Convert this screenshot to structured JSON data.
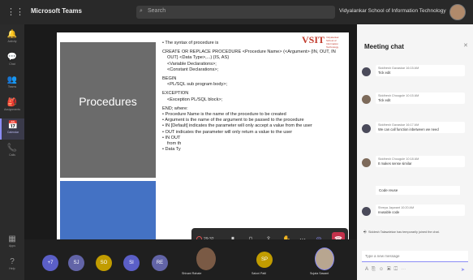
{
  "app": {
    "title": "Microsoft Teams",
    "search_placeholder": "Search",
    "org_name": "Vidyalankar School of Information Technology"
  },
  "rail": [
    {
      "icon": "bell-icon",
      "glyph": "🔔",
      "label": "Activity"
    },
    {
      "icon": "chat-icon",
      "glyph": "💬",
      "label": "Chat"
    },
    {
      "icon": "teams-icon",
      "glyph": "👥",
      "label": "Teams"
    },
    {
      "icon": "assignments-icon",
      "glyph": "🎒",
      "label": "Assignments"
    },
    {
      "icon": "calendar-icon",
      "glyph": "📅",
      "label": "Calendar"
    },
    {
      "icon": "calls-icon",
      "glyph": "📞",
      "label": "Calls"
    },
    {
      "icon": "apps-icon",
      "glyph": "▦",
      "label": "Apps"
    },
    {
      "icon": "help-icon",
      "glyph": "?",
      "label": "Help"
    }
  ],
  "slide": {
    "title": "Procedures",
    "logo": "VSIT",
    "logo_sub": "Vidyalankar School of Information Technology",
    "lines": [
      {
        "text": "The syntax of procedure is",
        "style": "bullet"
      },
      {
        "text": "CREATE OR REPLACE PROCEDURE <Procedure Name> (<Argument> {IN, OUT, IN",
        "style": "gap"
      },
      {
        "text": "OUT} <Data Type>,...) {IS, AS}",
        "style": "indent"
      },
      {
        "text": "<Variable Declarations>;",
        "style": "indent"
      },
      {
        "text": "<Constant Declarations>;",
        "style": "indent"
      },
      {
        "text": "BEGIN",
        "style": "gap"
      },
      {
        "text": "<PL/SQL sub program body>;",
        "style": "indent"
      },
      {
        "text": "EXCEPTION",
        "style": "gap"
      },
      {
        "text": "<Exception PL/SQL block>;",
        "style": "indent"
      },
      {
        "text": "END; where:",
        "style": "gap"
      },
      {
        "text": "Procedure Name is the name of the procedure to be created",
        "style": "bullet"
      },
      {
        "text": "Argument is the name of the argument to be passed to the procedure",
        "style": "bullet"
      },
      {
        "text": "IN [Default] indicates the parameter will only accept a value from the user",
        "style": "bullet"
      },
      {
        "text": "OUT indicates the parameter will only return a value to the user",
        "style": "bullet"
      },
      {
        "text": "IN OUT",
        "style": "bullet"
      },
      {
        "text": "from th",
        "style": "indent"
      },
      {
        "text": "Data Ty",
        "style": "bullet"
      }
    ]
  },
  "presenter_caption": "Sujata Sawant",
  "controls": {
    "timer": "29:32",
    "items": [
      "camera-icon",
      "mic-icon",
      "share-icon",
      "raise-hand-icon",
      "more-icon",
      "chat-toggle-icon",
      "participants-icon",
      "hangup-icon"
    ]
  },
  "participants": [
    {
      "initials": "+7",
      "color": "#5b5fc7"
    },
    {
      "initials": "SJ",
      "color": "#6264a7"
    },
    {
      "initials": "SO",
      "color": "#c19c00"
    },
    {
      "initials": "SI",
      "color": "#5b5fc7"
    },
    {
      "initials": "RE",
      "color": "#6264a7"
    }
  ],
  "named_tiles": [
    {
      "name": "Shivani Rahate",
      "type": "video"
    },
    {
      "initials": "SP",
      "name": "Saloni Patil",
      "type": "initials",
      "color": "#c19c00"
    },
    {
      "name": "Sujata Sawant",
      "type": "video-active"
    }
  ],
  "chat": {
    "title": "Meeting chat",
    "messages": [
      {
        "sender": "Siddhesh Gavaskar",
        "time": "16:15 AM",
        "text": "Tick edit",
        "avatar": "initials"
      },
      {
        "sender": "Siddhesh Chougule",
        "time": "10:15 AM",
        "text": "Tick edit",
        "avatar": "photo"
      },
      {
        "sender": "Siddhesh Gavaskar",
        "time": "16:17 AM",
        "text": "We can call function inbetween we need",
        "avatar": "initials"
      },
      {
        "sender": "Siddhesh Chougule",
        "time": "10:18 AM",
        "text": "It makes sense similar",
        "avatar": "photo"
      }
    ],
    "plain_message": "Code reuse",
    "last_message": {
      "sender": "Shreya Jaywant",
      "time": "10:20 AM",
      "text": "reusable code"
    },
    "system_notice": "Siddesh Talawdekar has temporarily joined the chat.",
    "compose_placeholder": "Type a new message"
  },
  "colors": {
    "accent": "#8b8cf5",
    "hangup": "#c4314b",
    "slide_panel": "#6b6b6b",
    "slide_blue": "#4472c4"
  }
}
